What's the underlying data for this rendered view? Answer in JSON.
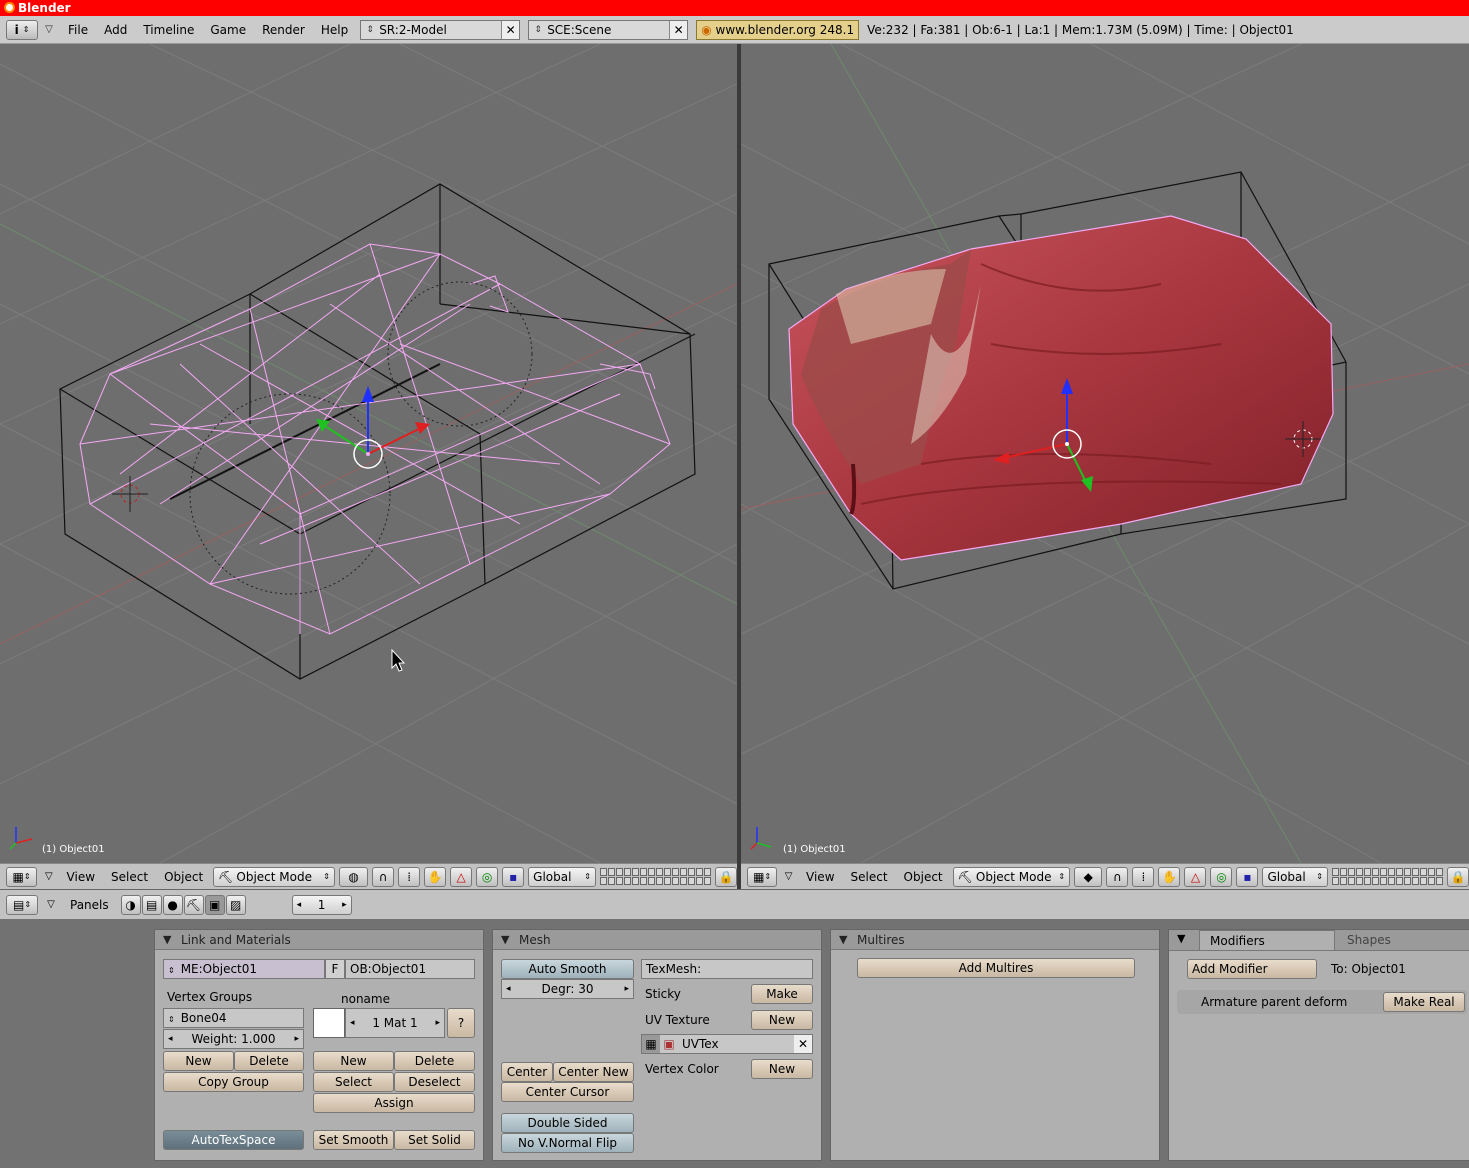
{
  "window": {
    "title": "Blender"
  },
  "menubar": {
    "menus": [
      "File",
      "Add",
      "Timeline",
      "Game",
      "Render",
      "Help"
    ],
    "screen_field": "SR:2-Model",
    "scene_field": "SCE:Scene",
    "url": "www.blender.org 248.1",
    "stats": "Ve:232 | Fa:381 | Ob:6-1 | La:1  | Mem:1.73M (5.09M)  | Time: | Object01"
  },
  "viewports": {
    "left": {
      "label": "(1) Object01"
    },
    "right": {
      "label": "(1) Object01"
    }
  },
  "viewport_header": {
    "menus": [
      "View",
      "Select",
      "Object"
    ],
    "mode": "Object Mode",
    "orientation": "Global"
  },
  "buttons_header": {
    "panels_label": "Panels",
    "frame": "1"
  },
  "link_materials": {
    "title": "Link and Materials",
    "me_field": "ME:Object01",
    "f_label": "F",
    "ob_field": "OB:Object01",
    "vertex_groups_label": "Vertex Groups",
    "group_name": "Bone04",
    "weight": "Weight: 1.000",
    "vg_new": "New",
    "vg_delete": "Delete",
    "copy_group": "Copy Group",
    "material_name": "noname",
    "mat_index": "1 Mat 1",
    "mat_q": "?",
    "mat_new": "New",
    "mat_delete": "Delete",
    "mat_select": "Select",
    "mat_deselect": "Deselect",
    "mat_assign": "Assign",
    "autotexspace": "AutoTexSpace",
    "set_smooth": "Set Smooth",
    "set_solid": "Set Solid"
  },
  "mesh": {
    "title": "Mesh",
    "auto_smooth": "Auto Smooth",
    "degr": "Degr: 30",
    "texmesh": "TexMesh:",
    "sticky_label": "Sticky",
    "sticky_make": "Make",
    "uv_texture_label": "UV Texture",
    "uv_new": "New",
    "uvtex": "UVTex",
    "vertex_color_label": "Vertex Color",
    "vc_new": "New",
    "center": "Center",
    "center_new": "Center New",
    "center_cursor": "Center Cursor",
    "double_sided": "Double Sided",
    "no_vnormal_flip": "No V.Normal Flip"
  },
  "multires": {
    "title": "Multires",
    "add_multires": "Add Multires"
  },
  "modifiers": {
    "tab_modifiers": "Modifiers",
    "tab_shapes": "Shapes",
    "add_modifier": "Add Modifier",
    "to_object": "To: Object01",
    "armature_parent": "Armature parent deform",
    "make_real": "Make Real"
  },
  "colors": {
    "titlebar": "#ff0000",
    "wire": "#f4a9f4",
    "mesh_red": "#b0444c",
    "viewport_bg": "#6e6e6e"
  }
}
